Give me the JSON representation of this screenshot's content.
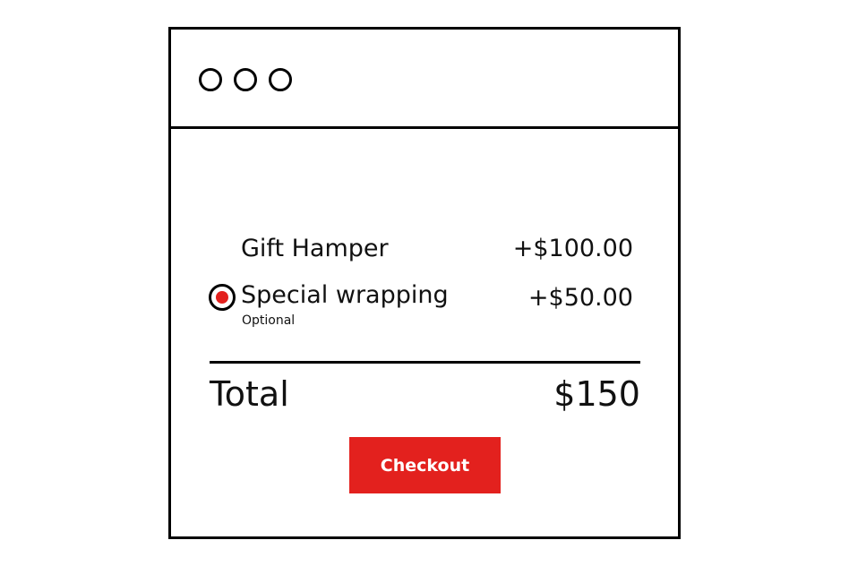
{
  "window_controls": [
    "circle-icon",
    "circle-icon",
    "circle-icon"
  ],
  "items": [
    {
      "label": "Gift Hamper",
      "price": "+$100.00"
    },
    {
      "label": "Special wrapping",
      "sublabel": "Optional",
      "price": "+$50.00",
      "selected": true
    }
  ],
  "total": {
    "label": "Total",
    "value": "$150"
  },
  "checkout": {
    "label": "Checkout"
  },
  "colors": {
    "accent": "#e3211e",
    "border": "#000000"
  }
}
